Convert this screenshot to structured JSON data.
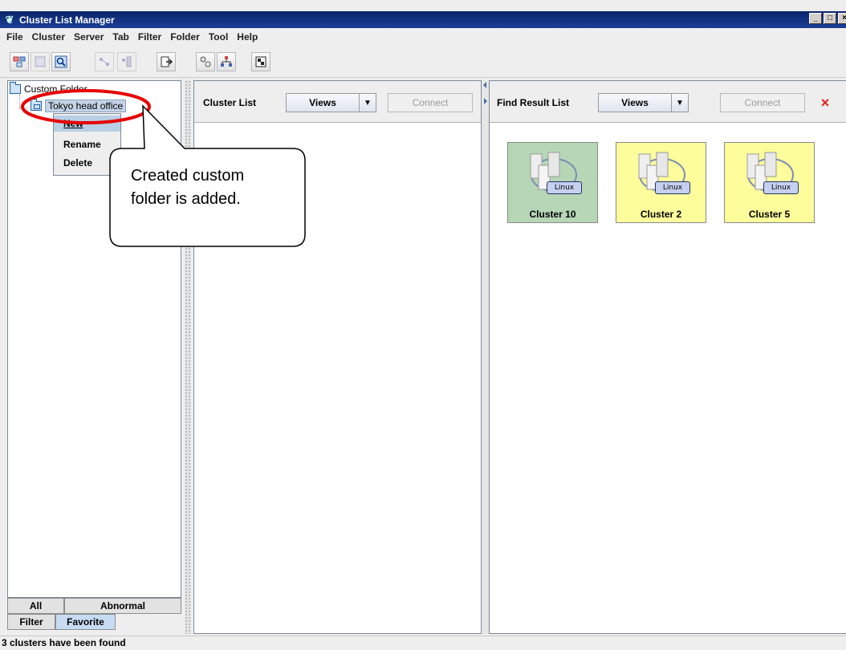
{
  "window": {
    "title": "Cluster List Manager",
    "controls": [
      "_",
      "□",
      "×"
    ]
  },
  "menu": [
    "File",
    "Cluster",
    "Server",
    "Tab",
    "Filter",
    "Folder",
    "Tool",
    "Help"
  ],
  "toolbar_icons": [
    "cluster-list-icon",
    "disabled-cluster-icon",
    "search-icon",
    "disabled-connect-icon",
    "disabled-disconnect-icon",
    "export-icon",
    "server-compare-icon",
    "network-icon",
    "status-icon"
  ],
  "tree": {
    "root": "Custom Folder",
    "child": "Tokyo head office"
  },
  "context_menu": {
    "items": [
      {
        "label": "New",
        "state": "highlighted"
      },
      {
        "label": "Rename",
        "state": "normal"
      },
      {
        "label": "Delete",
        "state": "normal"
      }
    ]
  },
  "callout": {
    "line1": "Created custom",
    "line2": "folder is added."
  },
  "tabs": {
    "row1": [
      "All",
      "Abnormal"
    ],
    "row2": [
      "Filter",
      "Favorite"
    ],
    "selected": "Favorite"
  },
  "cluster_panel": {
    "title": "Cluster List",
    "views": "Views",
    "connect": "Connect"
  },
  "find_panel": {
    "title": "Find Result List",
    "views": "Views",
    "connect": "Connect",
    "close": "×"
  },
  "clusters": [
    {
      "name": "Cluster 10",
      "os": "Linux",
      "status_color": "#b6d6b6"
    },
    {
      "name": "Cluster 2",
      "os": "Linux",
      "status_color": "#fdfd9c"
    },
    {
      "name": "Cluster 5",
      "os": "Linux",
      "status_color": "#fdfd9c"
    }
  ],
  "status": "3 clusters have been found"
}
